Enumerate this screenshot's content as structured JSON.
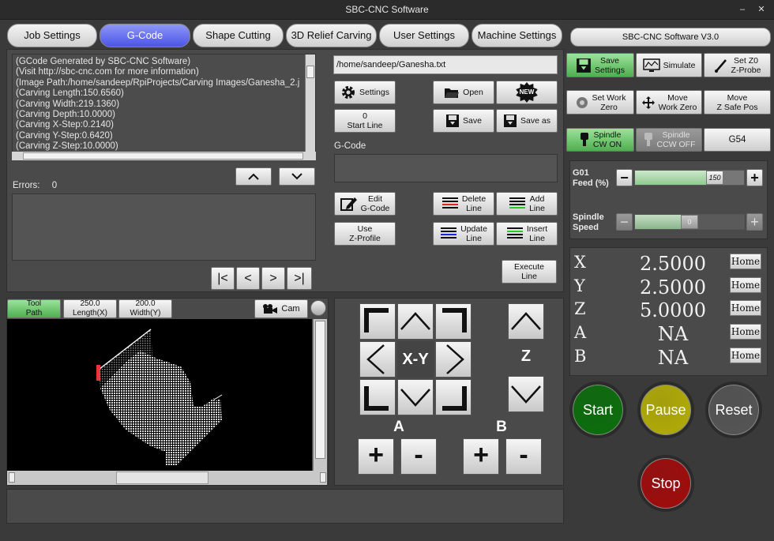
{
  "window": {
    "title": "SBC-CNC Software"
  },
  "tabs": [
    {
      "label": "Job Settings",
      "active": false
    },
    {
      "label": "G-Code",
      "active": true
    },
    {
      "label": "Shape Cutting",
      "active": false
    },
    {
      "label": "3D Relief Carving",
      "active": false
    },
    {
      "label": "User Settings",
      "active": false
    },
    {
      "label": "Machine Settings",
      "active": false
    }
  ],
  "version_label": "SBC-CNC Software V3.0",
  "gcode_text": [
    "(GCode Generated by SBC-CNC Software)",
    "(Visit http://sbc-cnc.com for more information)",
    "(Image Path:/home/sandeep/RpiProjects/Carving Images/Ganesha_2.j",
    "(Carving Length:150.6560)",
    "(Carving Width:219.1360)",
    "(Carving Depth:10.0000)",
    "(Carving X-Step:0.2140)",
    "(Carving Y-Step:0.6420)",
    "(Carving Z-Step:10.0000)"
  ],
  "errors": {
    "label": "Errors:",
    "count": "0"
  },
  "file_path": "/home/sandeep/Ganesha.txt",
  "buttons": {
    "settings": "Settings",
    "open": "Open",
    "new": "NEW",
    "start_line_num": "0",
    "start_line": "Start Line",
    "save": "Save",
    "save_as": "Save as",
    "gcode_label": "G-Code",
    "edit_gcode_1": "Edit",
    "edit_gcode_2": "G-Code",
    "delete_line_1": "Delete",
    "delete_line_2": "Line",
    "add_line_1": "Add",
    "add_line_2": "Line",
    "use_zprofile_1": "Use",
    "use_zprofile_2": "Z-Profile",
    "update_line_1": "Update",
    "update_line_2": "Line",
    "insert_line_1": "Insert",
    "insert_line_2": "Line",
    "execute_line_1": "Execute",
    "execute_line_2": "Line",
    "nav_first": "|<",
    "nav_prev": "<",
    "nav_next": ">",
    "nav_last": ">|"
  },
  "preview": {
    "tool_path_1": "Tool",
    "tool_path_2": "Path",
    "length_1": "250.0",
    "length_2": "Length(X)",
    "width_1": "200.0",
    "width_2": "Width(Y)",
    "cam": "Cam"
  },
  "jog": {
    "xy_label": "X-Y",
    "z_label": "Z",
    "a_label": "A",
    "b_label": "B",
    "plus": "+",
    "minus": "-"
  },
  "machine": {
    "save_settings_1": "Save",
    "save_settings_2": "Settings",
    "simulate": "Simulate",
    "set_z0_1": "Set Z0",
    "set_z0_2": "Z-Probe",
    "set_work_zero_1": "Set Work",
    "set_work_zero_2": "Zero",
    "move_work_zero_1": "Move",
    "move_work_zero_2": "Work Zero",
    "move_safe_1": "Move",
    "move_safe_2": "Z Safe Pos",
    "spindle_cw_1": "Spindle",
    "spindle_cw_2": "CW ON",
    "spindle_ccw_1": "Spindle",
    "spindle_ccw_2": "CCW OFF",
    "g54": "G54",
    "feed_label_1": "G01",
    "feed_label_2": "Feed (%)",
    "feed_value": "150",
    "feed_fraction": 0.78,
    "spindle_label_1": "Spindle",
    "spindle_label_2": "Speed",
    "spindle_value": "0",
    "spindle_fraction": 0.5
  },
  "axes": [
    {
      "name": "X",
      "value": "2.5000",
      "home": "Home"
    },
    {
      "name": "Y",
      "value": "2.5000",
      "home": "Home"
    },
    {
      "name": "Z",
      "value": "5.0000",
      "home": "Home"
    },
    {
      "name": "A",
      "value": "NA",
      "home": "Home"
    },
    {
      "name": "B",
      "value": "NA",
      "home": "Home"
    }
  ],
  "controls": {
    "start": "Start",
    "pause": "Pause",
    "reset": "Reset",
    "stop": "Stop"
  },
  "colors": {
    "start": "#0b6e0b",
    "pause": "#b3ad06",
    "reset": "#555555",
    "stop": "#a00b0b",
    "active_tab": "#5a63ee",
    "green_button": "#6cc56c"
  }
}
